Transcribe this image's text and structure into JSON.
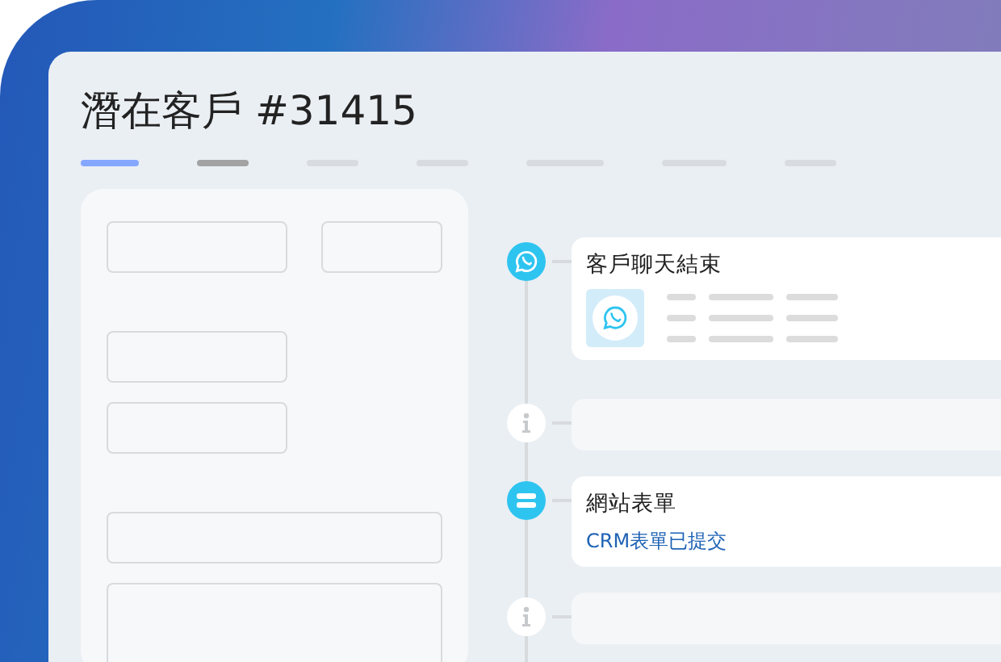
{
  "title": "潛在客戶 #31415",
  "tabs": [
    {
      "selected": true,
      "hovered": false
    },
    {
      "selected": false,
      "hovered": true
    },
    {
      "selected": false,
      "hovered": false
    },
    {
      "selected": false,
      "hovered": false
    },
    {
      "selected": false,
      "hovered": false
    },
    {
      "selected": false,
      "hovered": false
    },
    {
      "selected": false,
      "hovered": false
    }
  ],
  "timeline": [
    {
      "kind": "whatsapp",
      "title": "客戶聊天結束"
    },
    {
      "kind": "info"
    },
    {
      "kind": "form",
      "title": "網站表單",
      "subtitle": "CRM表單已提交"
    },
    {
      "kind": "info"
    }
  ]
}
